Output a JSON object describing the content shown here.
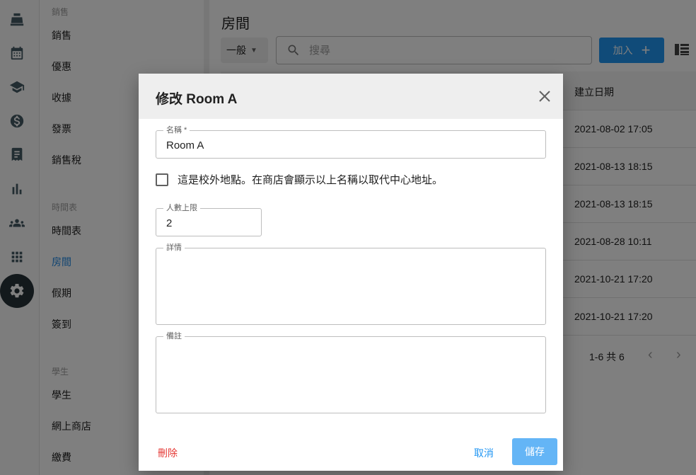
{
  "rail": {
    "icons": [
      "register-icon",
      "calendar-icon",
      "school-icon",
      "dollar-icon",
      "receipt-icon",
      "chart-icon",
      "people-icon",
      "apps-icon",
      "settings-icon"
    ]
  },
  "menu": {
    "sections": {
      "sales": "銷售",
      "timetable": "時間表",
      "students": "學生"
    },
    "items": {
      "sales": "銷售",
      "discount": "優惠",
      "receipts": "收據",
      "invoices": "發票",
      "sales_tax": "銷售稅",
      "timetable": "時間表",
      "rooms": "房間",
      "holidays": "假期",
      "checkin": "簽到",
      "students": "學生",
      "online_shop": "網上商店",
      "payment": "繳費"
    }
  },
  "main": {
    "title": "房間",
    "filter_value": "一般",
    "search_placeholder": "搜尋",
    "add_label": "加入",
    "table": {
      "header_created": "建立日期",
      "rows": [
        "2021-08-02 17:05",
        "2021-08-13 18:15",
        "2021-08-13 18:15",
        "2021-08-28 10:11",
        "2021-10-21 17:20",
        "2021-10-21 17:20"
      ]
    },
    "pager_text": "1-6 共 6"
  },
  "dialog": {
    "title": "修改 Room A",
    "name_label": "名稱 *",
    "name_value": "Room A",
    "offsite_label": "這是校外地點。在商店會顯示以上名稱以取代中心地址。",
    "offsite_checked": false,
    "capacity_label": "人數上限",
    "capacity_value": "2",
    "details_label": "詳情",
    "details_value": "",
    "remarks_label": "備註",
    "remarks_value": "",
    "delete_label": "刪除",
    "cancel_label": "取消",
    "save_label": "儲存"
  },
  "colors": {
    "primary": "#2196f3",
    "danger": "#e53935",
    "active_menu": "#1e88e5"
  }
}
